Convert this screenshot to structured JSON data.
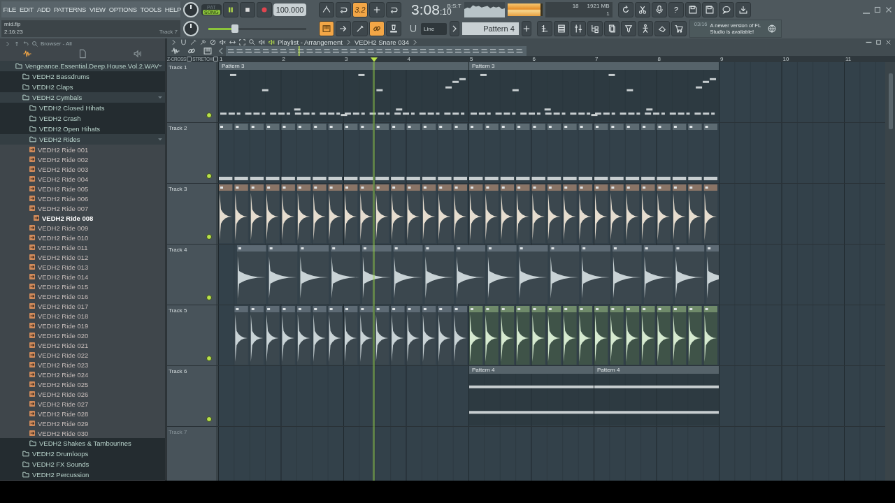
{
  "menu": [
    "FILE",
    "EDIT",
    "ADD",
    "PATTERNS",
    "VIEW",
    "OPTIONS",
    "TOOLS",
    "HELP"
  ],
  "project": {
    "file": "mid.flp",
    "time": "2:16:23",
    "hint": "Track 7"
  },
  "transport": {
    "modes": [
      {
        "label": "PAT",
        "selected": false
      },
      {
        "label": "SONG",
        "selected": true
      }
    ],
    "playing": true,
    "tempo": "100.000"
  },
  "tools_top": [
    {
      "on": false
    },
    {
      "on": false
    },
    {
      "label": "3.2",
      "on": true
    },
    {
      "on": false
    },
    {
      "on": false
    }
  ],
  "clock": {
    "main": "3:08",
    "fraction": ":10",
    "unit": "B:S:T"
  },
  "meter": {
    "level": 0.95
  },
  "cpu": {
    "polyphony": "18",
    "memory": "1921 MB",
    "count": "1"
  },
  "help": "?",
  "pitch": {
    "level": 0.27
  },
  "tools_bottom": [
    {
      "on": true
    },
    {
      "on": false
    },
    {
      "on": false
    },
    {
      "on": true
    },
    {
      "on": false
    }
  ],
  "snap": "Line",
  "pattern": "Pattern 4",
  "news": {
    "date": "03/16",
    "text": "A newer version of FL Studio is available!"
  },
  "browser": {
    "title": "Browser - All",
    "tree": [
      {
        "label": "Vengeance.Essential.Deep.House.Vol.2.WAV",
        "kind": "folder",
        "expanded": true,
        "children": [
          {
            "label": "VEDH2 Bassdrums",
            "kind": "folder",
            "expanded": false
          },
          {
            "label": "VEDH2 Claps",
            "kind": "folder",
            "expanded": false
          },
          {
            "label": "VEDH2 Cymbals",
            "kind": "folder",
            "expanded": true,
            "children": [
              {
                "label": "VEDH2 Closed Hihats",
                "kind": "folder",
                "expanded": false
              },
              {
                "label": "VEDH2 Crash",
                "kind": "folder",
                "expanded": false
              },
              {
                "label": "VEDH2 Open Hihats",
                "kind": "folder",
                "expanded": false
              },
              {
                "label": "VEDH2 Rides",
                "kind": "folder",
                "expanded": true,
                "children": [
                  {
                    "label": "VEDH2 Ride 001",
                    "kind": "file",
                    "selected": false
                  },
                  {
                    "label": "VEDH2 Ride 002",
                    "kind": "file",
                    "selected": false
                  },
                  {
                    "label": "VEDH2 Ride 003",
                    "kind": "file",
                    "selected": false
                  },
                  {
                    "label": "VEDH2 Ride 004",
                    "kind": "file",
                    "selected": false
                  },
                  {
                    "label": "VEDH2 Ride 005",
                    "kind": "file",
                    "selected": false
                  },
                  {
                    "label": "VEDH2 Ride 006",
                    "kind": "file",
                    "selected": false
                  },
                  {
                    "label": "VEDH2 Ride 007",
                    "kind": "file",
                    "selected": false
                  },
                  {
                    "label": "VEDH2 Ride 008",
                    "kind": "file",
                    "selected": true
                  },
                  {
                    "label": "VEDH2 Ride 009",
                    "kind": "file",
                    "selected": false
                  },
                  {
                    "label": "VEDH2 Ride 010",
                    "kind": "file",
                    "selected": false
                  },
                  {
                    "label": "VEDH2 Ride 011",
                    "kind": "file",
                    "selected": false
                  },
                  {
                    "label": "VEDH2 Ride 012",
                    "kind": "file",
                    "selected": false
                  },
                  {
                    "label": "VEDH2 Ride 013",
                    "kind": "file",
                    "selected": false
                  },
                  {
                    "label": "VEDH2 Ride 014",
                    "kind": "file",
                    "selected": false
                  },
                  {
                    "label": "VEDH2 Ride 015",
                    "kind": "file",
                    "selected": false
                  },
                  {
                    "label": "VEDH2 Ride 016",
                    "kind": "file",
                    "selected": false
                  },
                  {
                    "label": "VEDH2 Ride 017",
                    "kind": "file",
                    "selected": false
                  },
                  {
                    "label": "VEDH2 Ride 018",
                    "kind": "file",
                    "selected": false
                  },
                  {
                    "label": "VEDH2 Ride 019",
                    "kind": "file",
                    "selected": false
                  },
                  {
                    "label": "VEDH2 Ride 020",
                    "kind": "file",
                    "selected": false
                  },
                  {
                    "label": "VEDH2 Ride 021",
                    "kind": "file",
                    "selected": false
                  },
                  {
                    "label": "VEDH2 Ride 022",
                    "kind": "file",
                    "selected": false
                  },
                  {
                    "label": "VEDH2 Ride 023",
                    "kind": "file",
                    "selected": false
                  },
                  {
                    "label": "VEDH2 Ride 024",
                    "kind": "file",
                    "selected": false
                  },
                  {
                    "label": "VEDH2 Ride 025",
                    "kind": "file",
                    "selected": false
                  },
                  {
                    "label": "VEDH2 Ride 026",
                    "kind": "file",
                    "selected": false
                  },
                  {
                    "label": "VEDH2 Ride 027",
                    "kind": "file",
                    "selected": false
                  },
                  {
                    "label": "VEDH2 Ride 028",
                    "kind": "file",
                    "selected": false
                  },
                  {
                    "label": "VEDH2 Ride 029",
                    "kind": "file",
                    "selected": false
                  },
                  {
                    "label": "VEDH2 Ride 030",
                    "kind": "file",
                    "selected": false
                  }
                ]
              },
              {
                "label": "VEDH2 Shakes & Tambourines",
                "kind": "folder",
                "expanded": false
              }
            ]
          },
          {
            "label": "VEDH2 Drumloops",
            "kind": "folder",
            "expanded": false
          },
          {
            "label": "VEDH2 FX Sounds",
            "kind": "folder",
            "expanded": false
          },
          {
            "label": "VEDH2 Percussion",
            "kind": "folder",
            "expanded": false
          }
        ]
      }
    ]
  },
  "playlist": {
    "title": "Playlist - Arrangement",
    "clip": "VEDH2 Snare 034",
    "options": [
      {
        "label": "Z-CROSS",
        "checked": false
      },
      {
        "label": "STRETCH",
        "checked": false
      }
    ],
    "ruler": [
      "1",
      "2",
      "3",
      "4",
      "5",
      "6",
      "7",
      "8",
      "9",
      "10",
      "11"
    ],
    "tracks": [
      {
        "name": "Track 1",
        "kind": "pattern",
        "enabled": true,
        "clips": [
          {
            "label": "Pattern 3"
          },
          {
            "label": "Pattern 3"
          }
        ]
      },
      {
        "name": "Track 2",
        "kind": "oneshot",
        "enabled": true
      },
      {
        "name": "Track 3",
        "kind": "audio",
        "enabled": true
      },
      {
        "name": "Track 4",
        "kind": "audio",
        "enabled": true
      },
      {
        "name": "Track 5",
        "kind": "audio",
        "enabled": true
      },
      {
        "name": "Track 6",
        "kind": "pattern",
        "enabled": true,
        "clips": [
          {
            "label": "Pattern 4"
          },
          {
            "label": "Pattern 4"
          }
        ]
      },
      {
        "name": "Track 7",
        "kind": "empty",
        "enabled": false
      }
    ]
  }
}
